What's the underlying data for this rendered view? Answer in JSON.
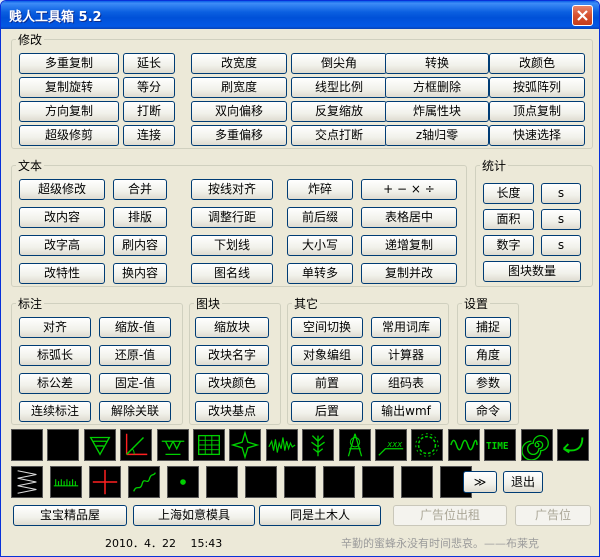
{
  "window": {
    "title": "贱人工具箱 5.2",
    "close_label": "✕"
  },
  "modify": {
    "legend": "修改",
    "rows": [
      [
        "多重复制",
        "延长",
        "改宽度",
        "倒尖角",
        "转换",
        "改颜色"
      ],
      [
        "复制旋转",
        "等分",
        "刷宽度",
        "线型比例",
        "方框删除",
        "按弧阵列"
      ],
      [
        "方向复制",
        "打断",
        "双向偏移",
        "反复缩放",
        "炸属性块",
        "顶点复制"
      ],
      [
        "超级修剪",
        "连接",
        "多重偏移",
        "交点打断",
        "z轴归零",
        "快速选择"
      ]
    ]
  },
  "text": {
    "legend": "文本",
    "rows": [
      [
        "超级修改",
        "合并",
        "按线对齐",
        "炸碎",
        "+ − × ÷"
      ],
      [
        "改内容",
        "排版",
        "调整行距",
        "前后缀",
        "表格居中"
      ],
      [
        "改字高",
        "刷内容",
        "下划线",
        "大小写",
        "递增复制"
      ],
      [
        "改特性",
        "换内容",
        "图名线",
        "单转多",
        "复制并改"
      ]
    ]
  },
  "stats": {
    "legend": "统计",
    "length": "长度",
    "area": "面积",
    "number": "数字",
    "s": "s",
    "block_count": "图块数量"
  },
  "dimension": {
    "legend": "标注",
    "rows": [
      [
        "对齐",
        "缩放-值"
      ],
      [
        "标弧长",
        "还原-值"
      ],
      [
        "标公差",
        "固定-值"
      ],
      [
        "连续标注",
        "解除关联"
      ]
    ]
  },
  "block": {
    "legend": "图块",
    "items": [
      "缩放块",
      "改块名字",
      "改块颜色",
      "改块基点"
    ]
  },
  "other": {
    "legend": "其它",
    "rows": [
      [
        "空间切换",
        "常用词库"
      ],
      [
        "对象编组",
        "计算器"
      ],
      [
        "前置",
        "组码表"
      ],
      [
        "后置",
        "输出wmf"
      ]
    ]
  },
  "settings": {
    "legend": "设置",
    "items": [
      "捕捉",
      "角度",
      "参数",
      "命令"
    ]
  },
  "toolbar": {
    "row1_icons": [
      "blank-icon",
      "blank-icon",
      "triangle-hatch-icon",
      "axis-angle-icon",
      "ground-hatch-icon",
      "grid-table-icon",
      "star-icon",
      "waveform-icon",
      "plant-icon",
      "compass-icon",
      "xxx-line-icon",
      "gear-circle-icon",
      "sine-wave-icon",
      "time-text-icon",
      "spiral-icon",
      "arrow-curve-icon"
    ],
    "row2_icons": [
      "zigzag-icon",
      "ruler-comb-icon",
      "cross-icon",
      "squiggle-icon",
      "dot-icon",
      "blank-icon",
      "blank-icon",
      "blank-icon",
      "blank-icon",
      "blank-icon",
      "blank-icon",
      "blank-icon"
    ],
    "more_label": "≫",
    "exit_label": "退出",
    "time_text": "TIME"
  },
  "links": [
    "宝宝精品屋",
    "上海如意模具",
    "同是土木人",
    "广告位出租",
    "广告位"
  ],
  "status": {
    "datetime": "2010．4．22　 15:43",
    "quote": "辛勤的蜜蜂永没有时间悲哀。——布莱克"
  },
  "colors": {
    "icon_green": "#00d000",
    "icon_red": "#ff2020",
    "title_blue": "#0a5fe0"
  }
}
